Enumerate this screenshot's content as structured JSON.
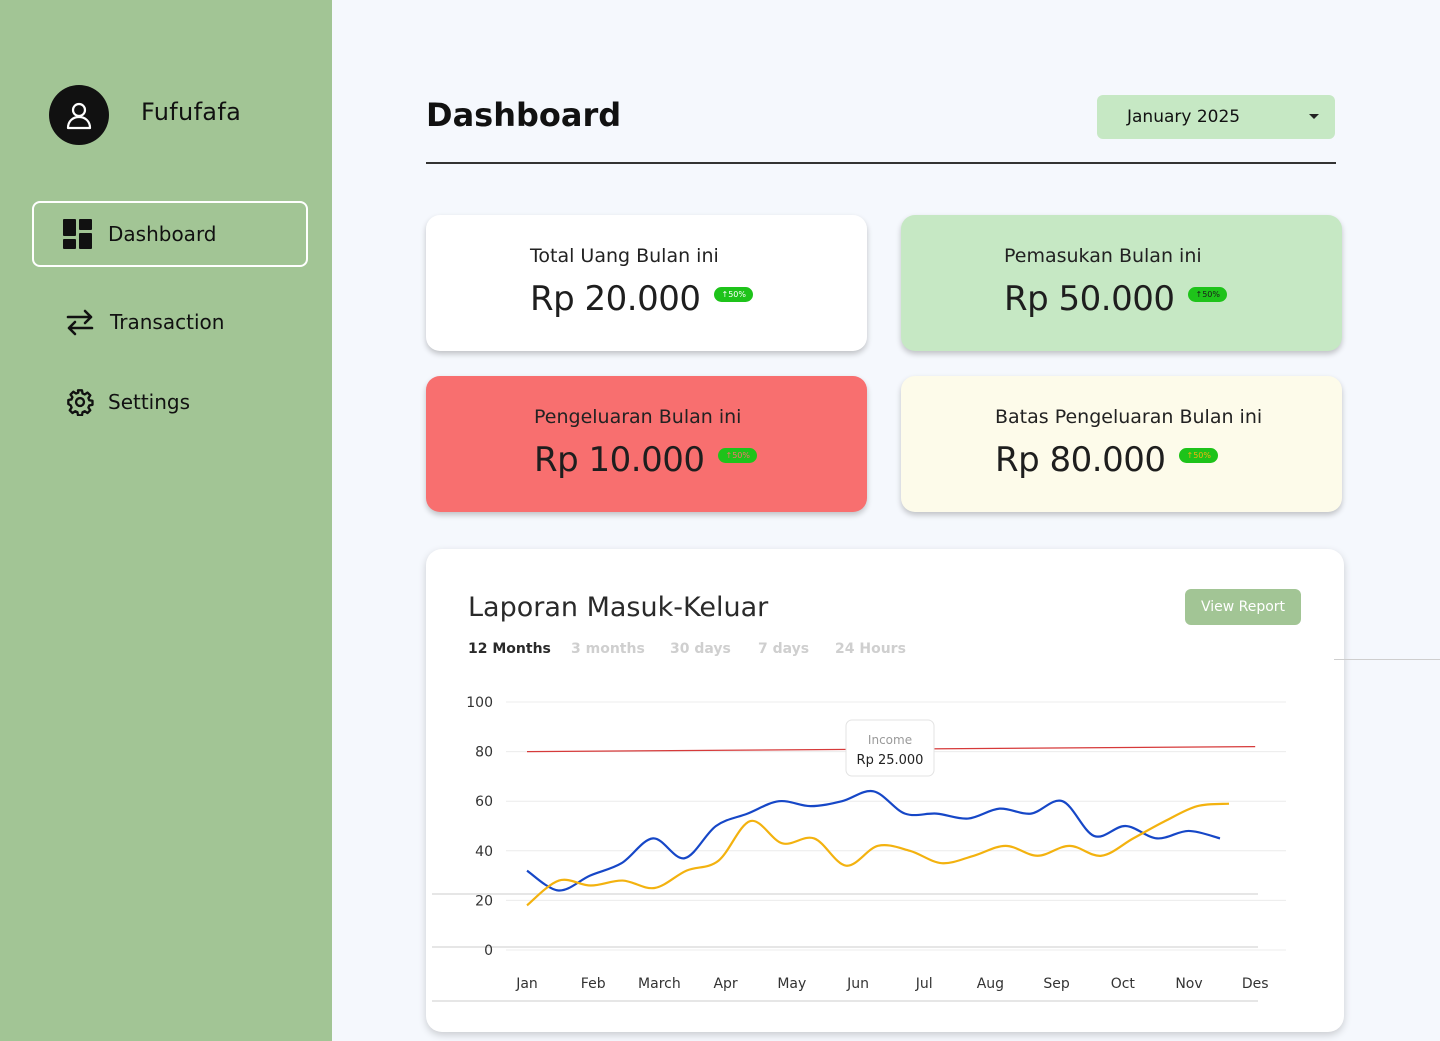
{
  "user": {
    "name": "Fufufafa"
  },
  "nav": [
    {
      "label": "Dashboard",
      "icon": "dashboard-grid-icon",
      "active": true
    },
    {
      "label": "Transaction",
      "icon": "transfer-arrows-icon",
      "active": false
    },
    {
      "label": "Settings",
      "icon": "gear-icon",
      "active": false
    }
  ],
  "header": {
    "title": "Dashboard",
    "period": "January 2025"
  },
  "cards": [
    {
      "title": "Total Uang Bulan ini",
      "value": "Rp 20.000",
      "badge": "↑50%",
      "color": "#ffffff"
    },
    {
      "title": "Pemasukan Bulan ini",
      "value": "Rp 50.000",
      "badge": "↑50%",
      "color": "#c6e8c4"
    },
    {
      "title": "Pengeluaran Bulan ini",
      "value": "Rp 10.000",
      "badge": "↑50%",
      "color": "#f86f6f"
    },
    {
      "title": "Batas Pengeluaran Bulan ini",
      "value": "Rp 80.000",
      "badge": "↑50%",
      "color": "#fdfbea"
    }
  ],
  "report": {
    "title": "Laporan Masuk-Keluar",
    "button": "View Report",
    "tabs": [
      "12 Months",
      "3 months",
      "30 days",
      "7 days",
      "24 Hours"
    ],
    "active_tab": "12 Months",
    "tooltip": {
      "label": "Income",
      "value": "Rp 25.000"
    }
  },
  "chart_data": {
    "type": "line",
    "categories": [
      "Jan",
      "Feb",
      "March",
      "Apr",
      "May",
      "Jun",
      "Jul",
      "Aug",
      "Sep",
      "Oct",
      "Nov",
      "Des"
    ],
    "yticks": [
      0,
      20,
      40,
      60,
      80,
      100
    ],
    "ylim": [
      0,
      100
    ],
    "grid": true,
    "limit_line": {
      "color": "#d63a3a",
      "from": 80,
      "to": 82
    },
    "series": [
      {
        "color": "#1647c7",
        "values": [
          32,
          24,
          30,
          35,
          45,
          37,
          50,
          55,
          60,
          58,
          60,
          64,
          55,
          55,
          53,
          57,
          55,
          60,
          46,
          50,
          45,
          48,
          45
        ]
      },
      {
        "color": "#f3b20f",
        "values": [
          18,
          28,
          26,
          28,
          25,
          32,
          36,
          52,
          43,
          45,
          34,
          42,
          40,
          35,
          38,
          42,
          38,
          42,
          38,
          45,
          52,
          58,
          59
        ]
      }
    ]
  }
}
